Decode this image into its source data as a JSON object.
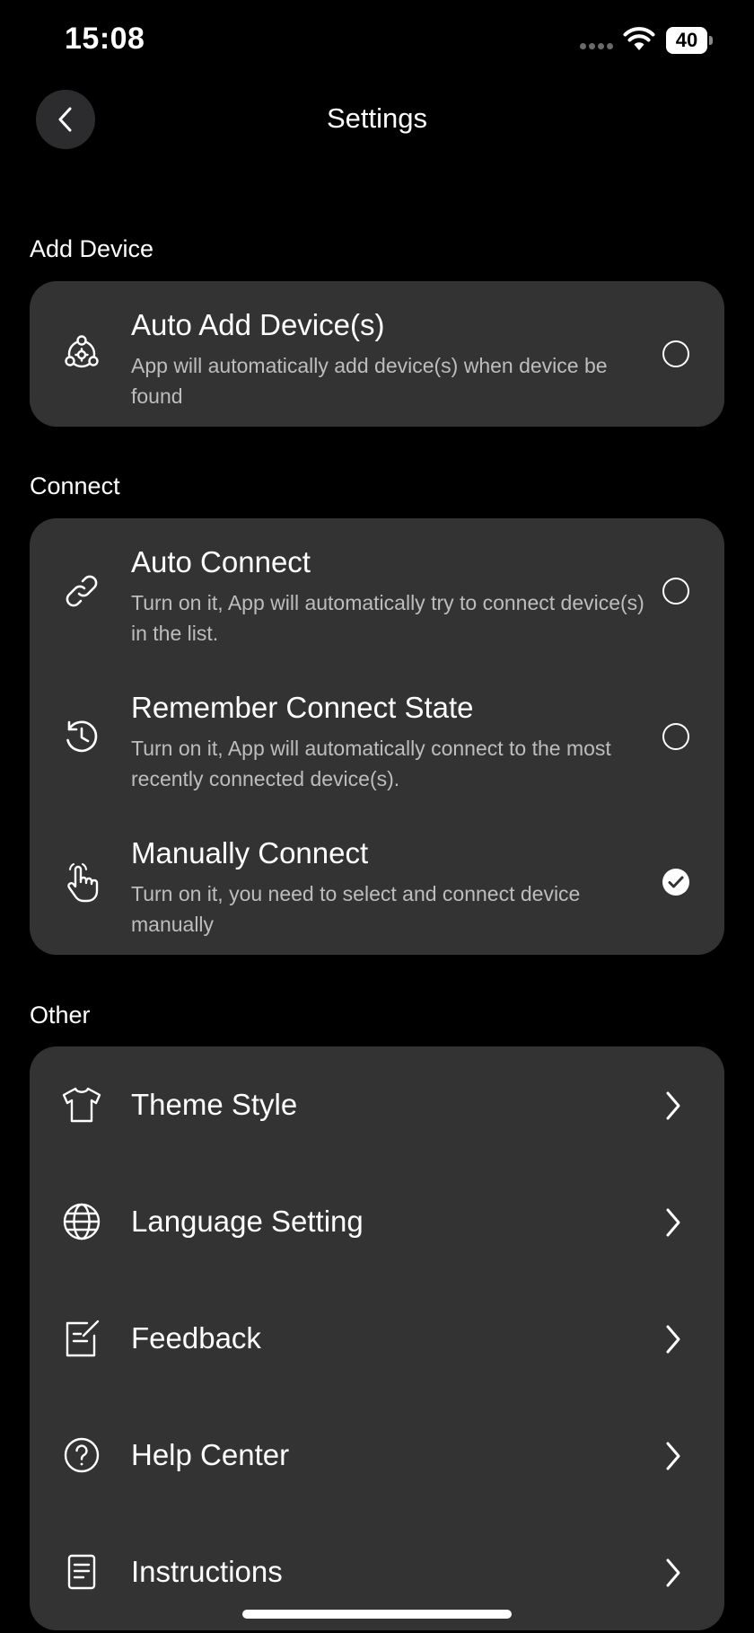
{
  "status_bar": {
    "time": "15:08",
    "battery_level": "40",
    "icons": [
      "signal-dots-icon",
      "wifi-icon",
      "battery-icon"
    ]
  },
  "header": {
    "title": "Settings",
    "back_icon": "chevron-left-icon"
  },
  "sections": {
    "add_device": {
      "heading": "Add Device",
      "items": [
        {
          "icon": "device-network-icon",
          "title": "Auto Add Device(s)",
          "description": "App will automatically add device(s) when device be found",
          "selected": false
        }
      ]
    },
    "connect": {
      "heading": "Connect",
      "items": [
        {
          "icon": "link-icon",
          "title": "Auto Connect",
          "description": "Turn on it, App will automatically try to connect device(s) in the list.",
          "selected": false
        },
        {
          "icon": "history-clock-icon",
          "title": "Remember Connect State",
          "description": "Turn on it, App will automatically connect to the most recently connected device(s).",
          "selected": false
        },
        {
          "icon": "hand-pointer-icon",
          "title": "Manually Connect",
          "description": "Turn on it, you need to select and connect device manually",
          "selected": true
        }
      ]
    },
    "other": {
      "heading": "Other",
      "items": [
        {
          "icon": "shirt-icon",
          "label": "Theme Style"
        },
        {
          "icon": "globe-icon",
          "label": "Language Setting"
        },
        {
          "icon": "feedback-edit-icon",
          "label": "Feedback"
        },
        {
          "icon": "help-circle-icon",
          "label": "Help Center"
        },
        {
          "icon": "document-icon",
          "label": "Instructions"
        }
      ]
    }
  },
  "colors": {
    "background": "#000000",
    "card": "#333333",
    "text_primary": "#ffffff",
    "text_secondary": "#bdbdbd"
  }
}
